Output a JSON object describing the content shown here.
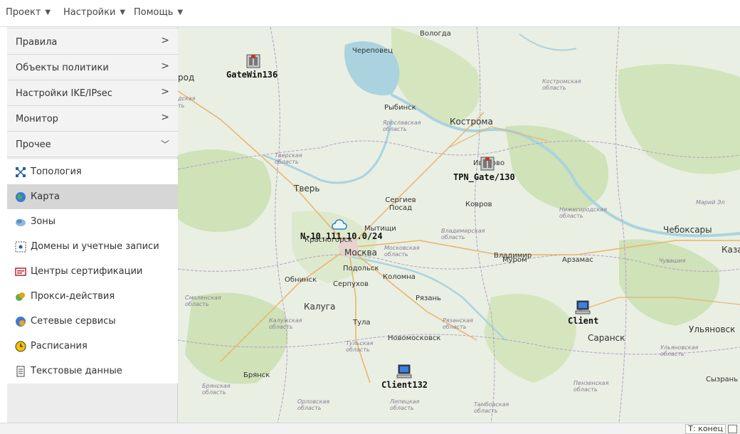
{
  "menubar": {
    "items": [
      "Проект",
      "Настройки",
      "Помощь"
    ]
  },
  "sidebar": {
    "sections": [
      {
        "label": "Правила",
        "expanded": false
      },
      {
        "label": "Объекты политики",
        "expanded": false
      },
      {
        "label": "Настройки IKE/IPsec",
        "expanded": false
      },
      {
        "label": "Монитор",
        "expanded": false
      },
      {
        "label": "Прочее",
        "expanded": true
      }
    ],
    "items": [
      {
        "label": "Топология",
        "icon": "topology-icon",
        "selected": false
      },
      {
        "label": "Карта",
        "icon": "globe-icon",
        "selected": true
      },
      {
        "label": "Зоны",
        "icon": "zones-icon",
        "selected": false
      },
      {
        "label": "Домены и учетные записи",
        "icon": "domain-icon",
        "selected": false
      },
      {
        "label": "Центры сертификации",
        "icon": "certificate-icon",
        "selected": false
      },
      {
        "label": "Прокси-действия",
        "icon": "proxy-icon",
        "selected": false
      },
      {
        "label": "Сетевые сервисы",
        "icon": "network-services-icon",
        "selected": false
      },
      {
        "label": "Расписания",
        "icon": "clock-icon",
        "selected": false
      },
      {
        "label": "Текстовые данные",
        "icon": "document-icon",
        "selected": false
      }
    ]
  },
  "map": {
    "cities": [
      "Вологда",
      "Череповец",
      "род",
      "Рыбинск",
      "Кострома",
      "Иваново",
      "Тверь",
      "Сергиев Посад",
      "Ковров",
      "Мытищи",
      "Красногорск",
      "Москва",
      "Владимир",
      "Муром",
      "Арзамас",
      "Чебоксары",
      "Каза",
      "Подольск",
      "Коломна",
      "Обнинск",
      "Серпухов",
      "Рязань",
      "Калуга",
      "Тула",
      "Новомосковск",
      "Саранск",
      "Ульяновск",
      "Брянск",
      "Сызрань"
    ],
    "regions": [
      "Костромская область",
      "Ярославская область",
      "Тверская область",
      "Нижегородская область",
      "Марий Эл",
      "Владимирская область",
      "Московская область",
      "Чувашия",
      "Смоленская область",
      "Калужская область",
      "Рязанская область",
      "Тульская область",
      "Ульяновская область",
      "Брянская область",
      "Орловская область",
      "Липецкая область",
      "Тамбовская область",
      "Пензенская область",
      "дская",
      "ть"
    ],
    "nodes": [
      {
        "name": "GateWin136",
        "type": "gateway"
      },
      {
        "name": "TPN_Gate/130",
        "type": "gateway"
      },
      {
        "name": "N-10.111.10.0/24",
        "type": "network"
      },
      {
        "name": "Client",
        "type": "client"
      },
      {
        "name": "Client132",
        "type": "client"
      }
    ]
  },
  "statusbar": {
    "text": "Т: конец"
  },
  "colors": {
    "water": "#aad3df",
    "land": "#e9efe3",
    "forest": "#cfe2b8",
    "selected": "#d6d6d6"
  }
}
